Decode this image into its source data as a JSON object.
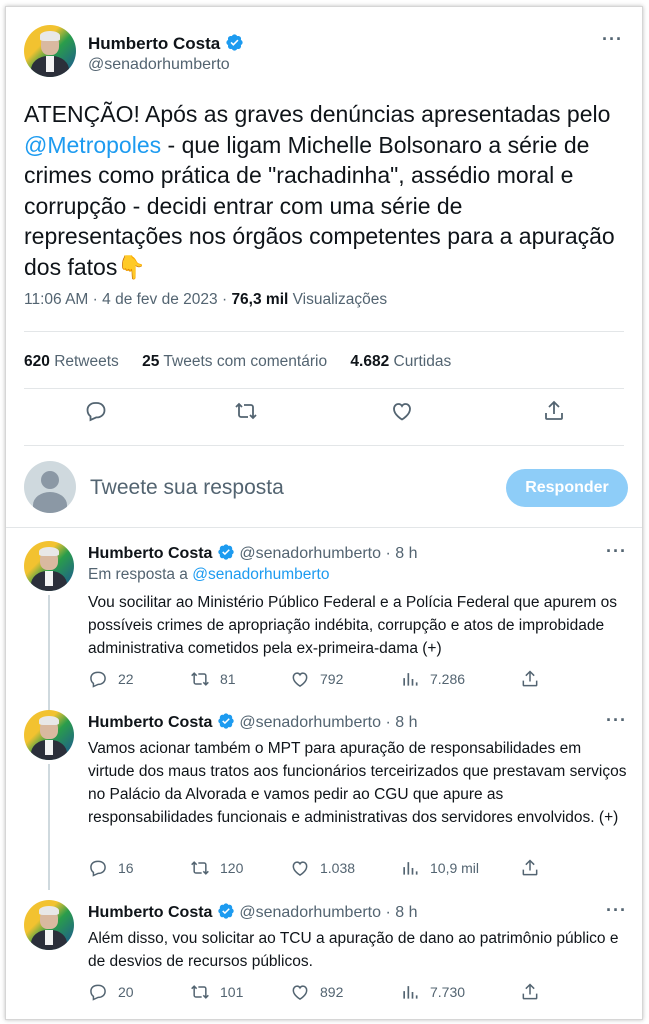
{
  "main_tweet": {
    "name": "Humberto Costa",
    "handle": "@senadorhumberto",
    "text_before": "ATENÇÃO! Após as graves denúncias apresentadas pelo ",
    "mention": "@Metropoles",
    "text_after": " - que ligam Michelle Bolsonaro a série de crimes como prática de \"rachadinha\", assédio moral e corrupção - decidi entrar com uma série de representações nos órgãos competentes para a apuração dos fatos",
    "emoji": "👇",
    "time": "11:06 AM",
    "separator": "·",
    "date": "4 de fev de 2023",
    "views_count": "76,3 mil",
    "views_label": "Visualizações",
    "more_icon": "···",
    "stats": {
      "retweets_count": "620",
      "retweets_label": "Retweets",
      "quotes_count": "25",
      "quotes_label": "Tweets com comentário",
      "likes_count": "4.682",
      "likes_label": "Curtidas"
    },
    "actions": [
      "reply-icon",
      "retweet-icon",
      "like-icon",
      "share-icon"
    ]
  },
  "reply_box": {
    "placeholder": "Tweete sua resposta",
    "button": "Responder"
  },
  "thread": [
    {
      "name": "Humberto Costa",
      "handle": "@senadorhumberto",
      "sep": "·",
      "time": "8 h",
      "in_reply_label": "Em resposta a",
      "in_reply_handle": "@senadorhumberto",
      "text": "Vou socilitar ao Ministério Público Federal e a Polícia Federal que apurem os possíveis crimes de apropriação indébita, corrupção e atos de improbidade administrativa cometidos pela ex-primeira-dama (+)",
      "replies": "22",
      "retweets": "81",
      "likes": "792",
      "views": "7.286"
    },
    {
      "name": "Humberto Costa",
      "handle": "@senadorhumberto",
      "sep": "·",
      "time": "8 h",
      "text": "Vamos acionar também o  MPT para apuração de responsabilidades em virtude dos maus tratos aos funcionários terceirizados que prestavam serviços no Palácio da Alvorada e vamos pedir ao CGU que apure as responsabilidades funcionais e administrativas dos servidores envolvidos. (+)",
      "replies": "16",
      "retweets": "120",
      "likes": "1.038",
      "views": "10,9 mil"
    },
    {
      "name": "Humberto Costa",
      "handle": "@senadorhumberto",
      "sep": "·",
      "time": "8 h",
      "text": "Além disso, vou solicitar ao TCU a apuração de dano ao patrimônio público e de desvios de recursos públicos.",
      "replies": "20",
      "retweets": "101",
      "likes": "892",
      "views": "7.730"
    }
  ],
  "colors": {
    "accent": "#1d9bf0",
    "muted": "#536471",
    "button_disabled": "#8ecdf8"
  }
}
